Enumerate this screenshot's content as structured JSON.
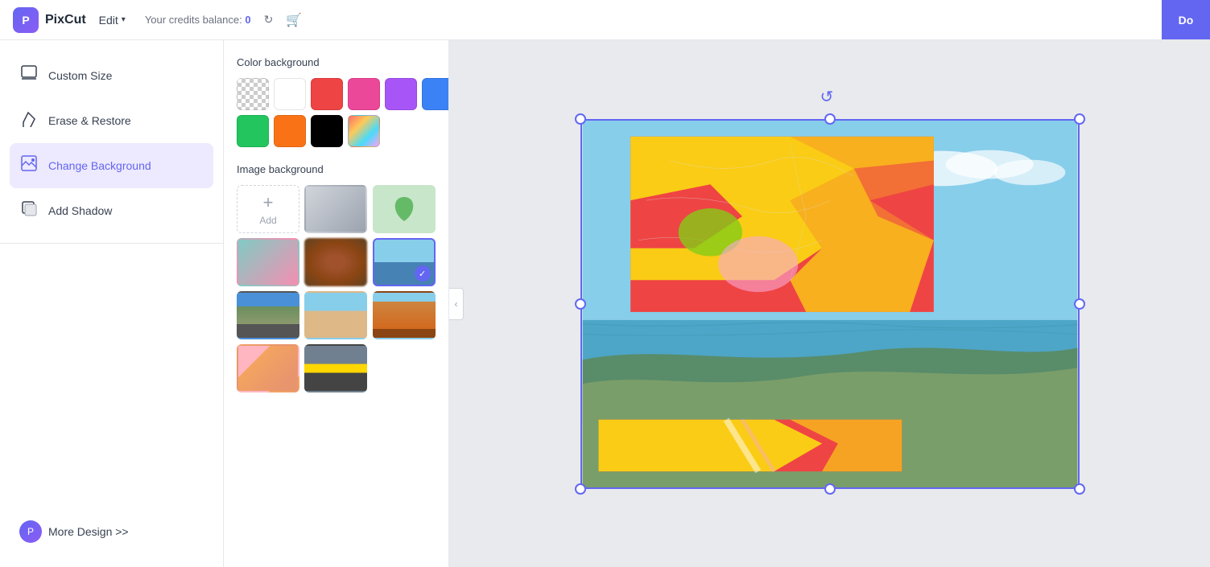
{
  "header": {
    "logo_text": "PixCut",
    "edit_label": "Edit",
    "credits_prefix": "Your credits balance:",
    "credits_value": "0",
    "download_label": "Do"
  },
  "sidebar": {
    "items": [
      {
        "id": "custom-size",
        "label": "Custom Size",
        "icon": "⊞"
      },
      {
        "id": "erase-restore",
        "label": "Erase & Restore",
        "icon": "✏"
      },
      {
        "id": "change-background",
        "label": "Change Background",
        "icon": "⊡",
        "active": true
      },
      {
        "id": "add-shadow",
        "label": "Add Shadow",
        "icon": "▣"
      }
    ],
    "more_design_label": "More Design >>"
  },
  "panel": {
    "color_section_title": "Color background",
    "image_section_title": "Image background",
    "colors": [
      "transparent",
      "white",
      "red",
      "pink",
      "purple",
      "blue",
      "green",
      "orange",
      "black",
      "gradient"
    ],
    "add_label": "Add"
  },
  "canvas": {
    "rotate_hint": "rotate"
  }
}
